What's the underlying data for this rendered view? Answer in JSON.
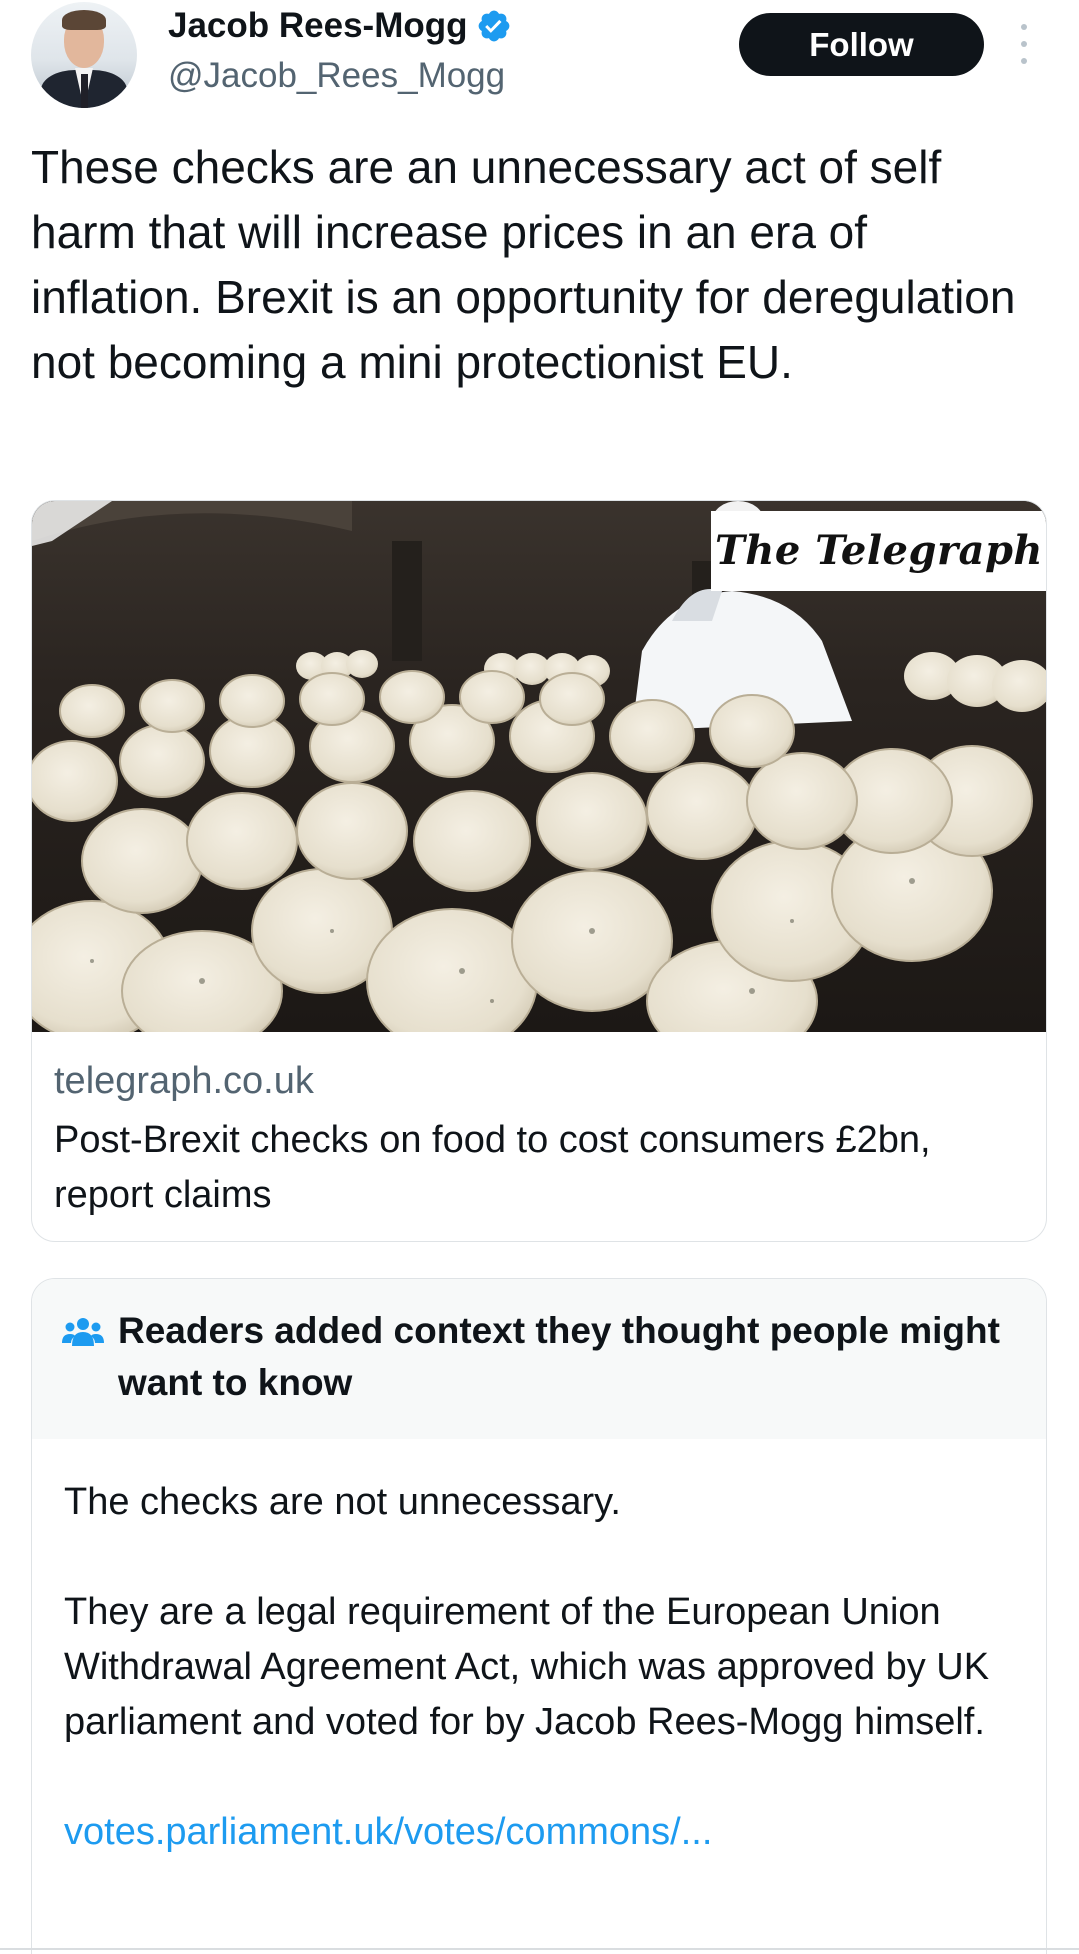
{
  "author": {
    "name": "Jacob Rees-Mogg",
    "handle": "@Jacob_Rees_Mogg",
    "verified": true,
    "avatar_icon": "profile-photo"
  },
  "actions": {
    "follow_label": "Follow",
    "more_icon": "more-vertical-icon"
  },
  "tweet": {
    "text": "These checks are an unnecessary act of self harm that will increase prices in an era of inflation.  Brexit is an opportunity for deregulation not becoming a mini protectionist EU."
  },
  "card": {
    "image_masthead": "The Telegraph",
    "domain": "telegraph.co.uk",
    "title": "Post-Brexit checks on food to cost consumers £2bn, report claims"
  },
  "community_note": {
    "icon": "people-icon",
    "header": "Readers added context they thought people might want to know",
    "line1": "The checks are not unnecessary.",
    "paragraph2": "They are a legal requirement of the European Union Withdrawal Agreement Act, which was approved by UK parliament and voted for by Jacob Rees-Mogg himself.",
    "link": "votes.parliament.uk/votes/commons/..."
  },
  "colors": {
    "text": "#0f1419",
    "secondary": "#536471",
    "link": "#1d9bf0",
    "verified": "#1d9bf0",
    "note_header_bg": "#f7f9f9"
  }
}
